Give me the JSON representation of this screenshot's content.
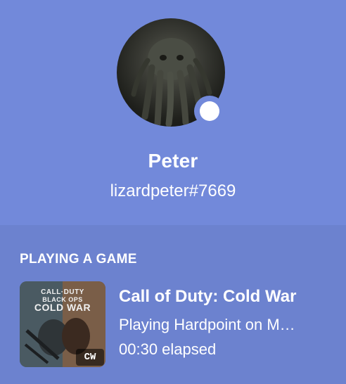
{
  "profile": {
    "display_name": "Peter",
    "username_tag": "lizardpeter#7669",
    "status": "online",
    "avatar_icon": "cthulhu-avatar"
  },
  "activity": {
    "section_title": "PLAYING A GAME",
    "game_name": "Call of Duty: Cold War",
    "details": "Playing Hardpoint on M…",
    "elapsed": "00:30 elapsed",
    "art": {
      "line1": "CALL·DUTY",
      "line2": "BLACK OPS",
      "line3": "COLD WAR",
      "badge": "CW"
    }
  },
  "colors": {
    "header_bg": "#7289da",
    "activity_bg": "#6c82cf",
    "text": "#ffffff"
  }
}
